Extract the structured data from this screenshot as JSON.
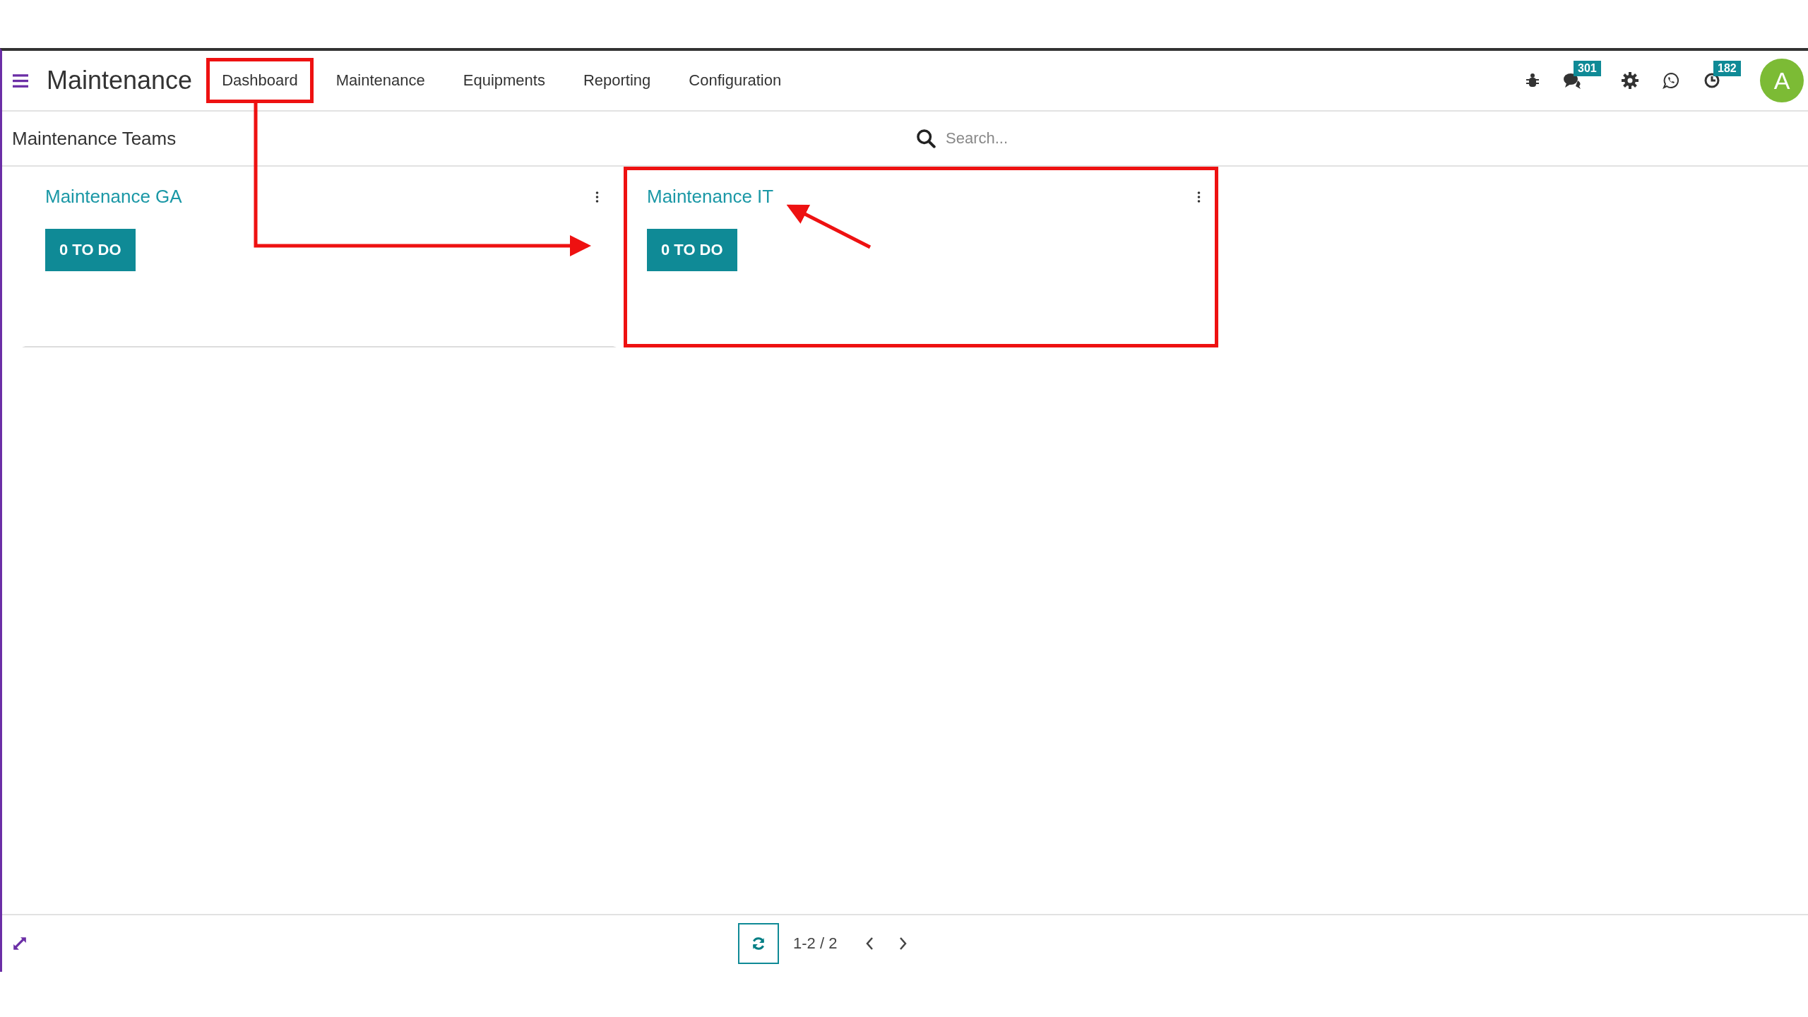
{
  "app": {
    "name": "Maintenance"
  },
  "menu": [
    {
      "label": "Dashboard",
      "highlighted": true
    },
    {
      "label": "Maintenance",
      "highlighted": false
    },
    {
      "label": "Equipments",
      "highlighted": false
    },
    {
      "label": "Reporting",
      "highlighted": false
    },
    {
      "label": "Configuration",
      "highlighted": false
    }
  ],
  "systray": [
    {
      "kind": "bug"
    },
    {
      "kind": "chat",
      "badge": "301"
    },
    {
      "kind": "gear"
    },
    {
      "kind": "whatsapp"
    },
    {
      "kind": "clock",
      "badge": "182"
    }
  ],
  "avatar": {
    "initial": "A"
  },
  "control_panel": {
    "title": "Maintenance Teams",
    "search": {
      "placeholder": "Search..."
    }
  },
  "teams": [
    {
      "name": "Maintenance GA",
      "button": "0 TO DO",
      "highlighted": false
    },
    {
      "name": "Maintenance IT",
      "button": "0 TO DO",
      "highlighted": true
    }
  ],
  "pager": {
    "value": "1-2 / 2"
  }
}
